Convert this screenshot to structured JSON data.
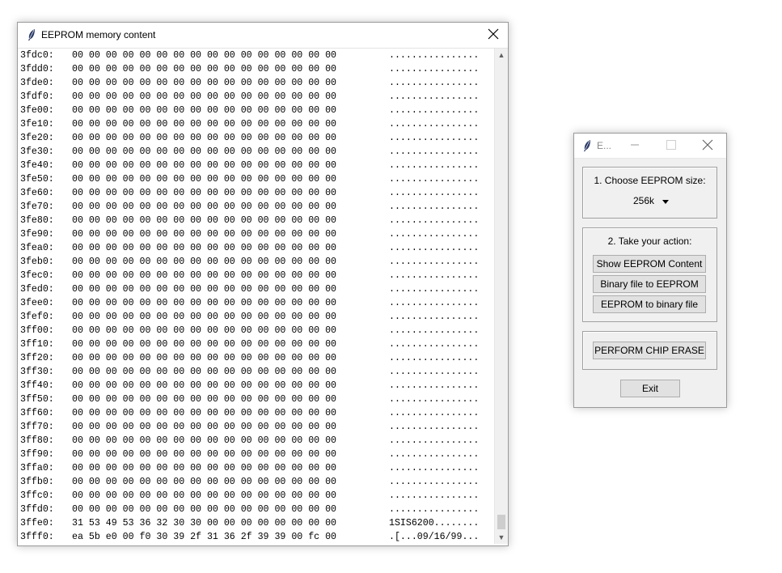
{
  "memory_window": {
    "title": "EEPROM memory content",
    "icons": {
      "app": "feather-icon",
      "close": "close-icon"
    },
    "rows": [
      {
        "addr": "3fdc0:",
        "bytes": "00 00 00 00 00 00 00 00 00 00 00 00 00 00 00 00",
        "ascii": "................"
      },
      {
        "addr": "3fdd0:",
        "bytes": "00 00 00 00 00 00 00 00 00 00 00 00 00 00 00 00",
        "ascii": "................"
      },
      {
        "addr": "3fde0:",
        "bytes": "00 00 00 00 00 00 00 00 00 00 00 00 00 00 00 00",
        "ascii": "................"
      },
      {
        "addr": "3fdf0:",
        "bytes": "00 00 00 00 00 00 00 00 00 00 00 00 00 00 00 00",
        "ascii": "................"
      },
      {
        "addr": "3fe00:",
        "bytes": "00 00 00 00 00 00 00 00 00 00 00 00 00 00 00 00",
        "ascii": "................"
      },
      {
        "addr": "3fe10:",
        "bytes": "00 00 00 00 00 00 00 00 00 00 00 00 00 00 00 00",
        "ascii": "................"
      },
      {
        "addr": "3fe20:",
        "bytes": "00 00 00 00 00 00 00 00 00 00 00 00 00 00 00 00",
        "ascii": "................"
      },
      {
        "addr": "3fe30:",
        "bytes": "00 00 00 00 00 00 00 00 00 00 00 00 00 00 00 00",
        "ascii": "................"
      },
      {
        "addr": "3fe40:",
        "bytes": "00 00 00 00 00 00 00 00 00 00 00 00 00 00 00 00",
        "ascii": "................"
      },
      {
        "addr": "3fe50:",
        "bytes": "00 00 00 00 00 00 00 00 00 00 00 00 00 00 00 00",
        "ascii": "................"
      },
      {
        "addr": "3fe60:",
        "bytes": "00 00 00 00 00 00 00 00 00 00 00 00 00 00 00 00",
        "ascii": "................"
      },
      {
        "addr": "3fe70:",
        "bytes": "00 00 00 00 00 00 00 00 00 00 00 00 00 00 00 00",
        "ascii": "................"
      },
      {
        "addr": "3fe80:",
        "bytes": "00 00 00 00 00 00 00 00 00 00 00 00 00 00 00 00",
        "ascii": "................"
      },
      {
        "addr": "3fe90:",
        "bytes": "00 00 00 00 00 00 00 00 00 00 00 00 00 00 00 00",
        "ascii": "................"
      },
      {
        "addr": "3fea0:",
        "bytes": "00 00 00 00 00 00 00 00 00 00 00 00 00 00 00 00",
        "ascii": "................"
      },
      {
        "addr": "3feb0:",
        "bytes": "00 00 00 00 00 00 00 00 00 00 00 00 00 00 00 00",
        "ascii": "................"
      },
      {
        "addr": "3fec0:",
        "bytes": "00 00 00 00 00 00 00 00 00 00 00 00 00 00 00 00",
        "ascii": "................"
      },
      {
        "addr": "3fed0:",
        "bytes": "00 00 00 00 00 00 00 00 00 00 00 00 00 00 00 00",
        "ascii": "................"
      },
      {
        "addr": "3fee0:",
        "bytes": "00 00 00 00 00 00 00 00 00 00 00 00 00 00 00 00",
        "ascii": "................"
      },
      {
        "addr": "3fef0:",
        "bytes": "00 00 00 00 00 00 00 00 00 00 00 00 00 00 00 00",
        "ascii": "................"
      },
      {
        "addr": "3ff00:",
        "bytes": "00 00 00 00 00 00 00 00 00 00 00 00 00 00 00 00",
        "ascii": "................"
      },
      {
        "addr": "3ff10:",
        "bytes": "00 00 00 00 00 00 00 00 00 00 00 00 00 00 00 00",
        "ascii": "................"
      },
      {
        "addr": "3ff20:",
        "bytes": "00 00 00 00 00 00 00 00 00 00 00 00 00 00 00 00",
        "ascii": "................"
      },
      {
        "addr": "3ff30:",
        "bytes": "00 00 00 00 00 00 00 00 00 00 00 00 00 00 00 00",
        "ascii": "................"
      },
      {
        "addr": "3ff40:",
        "bytes": "00 00 00 00 00 00 00 00 00 00 00 00 00 00 00 00",
        "ascii": "................"
      },
      {
        "addr": "3ff50:",
        "bytes": "00 00 00 00 00 00 00 00 00 00 00 00 00 00 00 00",
        "ascii": "................"
      },
      {
        "addr": "3ff60:",
        "bytes": "00 00 00 00 00 00 00 00 00 00 00 00 00 00 00 00",
        "ascii": "................"
      },
      {
        "addr": "3ff70:",
        "bytes": "00 00 00 00 00 00 00 00 00 00 00 00 00 00 00 00",
        "ascii": "................"
      },
      {
        "addr": "3ff80:",
        "bytes": "00 00 00 00 00 00 00 00 00 00 00 00 00 00 00 00",
        "ascii": "................"
      },
      {
        "addr": "3ff90:",
        "bytes": "00 00 00 00 00 00 00 00 00 00 00 00 00 00 00 00",
        "ascii": "................"
      },
      {
        "addr": "3ffa0:",
        "bytes": "00 00 00 00 00 00 00 00 00 00 00 00 00 00 00 00",
        "ascii": "................"
      },
      {
        "addr": "3ffb0:",
        "bytes": "00 00 00 00 00 00 00 00 00 00 00 00 00 00 00 00",
        "ascii": "................"
      },
      {
        "addr": "3ffc0:",
        "bytes": "00 00 00 00 00 00 00 00 00 00 00 00 00 00 00 00",
        "ascii": "................"
      },
      {
        "addr": "3ffd0:",
        "bytes": "00 00 00 00 00 00 00 00 00 00 00 00 00 00 00 00",
        "ascii": "................"
      },
      {
        "addr": "3ffe0:",
        "bytes": "31 53 49 53 36 32 30 30 00 00 00 00 00 00 00 00",
        "ascii": "1SIS6200........"
      },
      {
        "addr": "3fff0:",
        "bytes": "ea 5b e0 00 f0 30 39 2f 31 36 2f 39 39 00 fc 00",
        "ascii": ".[...09/16/99..."
      }
    ]
  },
  "control_window": {
    "title": "E...",
    "icons": {
      "app": "feather-icon",
      "minimize": "minimize-icon",
      "maximize": "maximize-icon",
      "close": "close-icon"
    },
    "size_group": {
      "label": "1. Choose EEPROM size:",
      "selected": "256k"
    },
    "action_group": {
      "label": "2. Take your action:",
      "buttons": [
        "Show EEPROM Content",
        "Binary file to EEPROM",
        "EEPROM to binary file"
      ]
    },
    "erase_button": "PERFORM CHIP ERASE",
    "exit_button": "Exit"
  }
}
